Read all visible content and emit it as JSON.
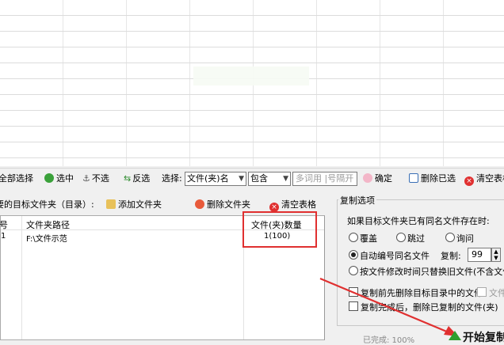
{
  "toolbar": {
    "select_all": "全部选择",
    "check": "选中",
    "uncheck": "不选",
    "invert": "反选",
    "select_label": "选择:",
    "select_type": "文件(夹)名",
    "select_mode": "包含",
    "filter_placeholder": "多词用 |号隔开",
    "confirm": "确定",
    "delete_selected": "删除已选",
    "clear_table": "清空表格"
  },
  "subbar": {
    "target_label": "要的目标文件夹（目录）:",
    "add_folder": "添加文件夹",
    "delete_folder": "删除文件夹",
    "clear_table": "清空表格"
  },
  "table": {
    "columns": [
      "号",
      "文件夹路径",
      "文件(夹)数量"
    ],
    "rows": [
      {
        "index": "1",
        "path": "F:\\文件示范",
        "count": "1(100)"
      }
    ]
  },
  "copy_options": {
    "title": "复制选项",
    "exists_prompt": "如果目标文件夹已有同名文件存在时:",
    "overwrite": "覆盖",
    "skip": "跳过",
    "ask": "询问",
    "auto_number": "自动编号同名文件",
    "copies_label": "复制:",
    "copies_value": "99",
    "by_time": "按文件修改时间只替换旧文件(不含文件夹",
    "delete_before": "复制前先删除目标目录中的文件",
    "file_partial": "文件",
    "delete_after": "复制完成后，删除已复制的文件(夹)"
  },
  "status": {
    "progress": "已完成: 100%",
    "start_button": "开始复制"
  },
  "colors": {
    "annotation": "#e03030",
    "start_icon": "#2f9e2f"
  }
}
